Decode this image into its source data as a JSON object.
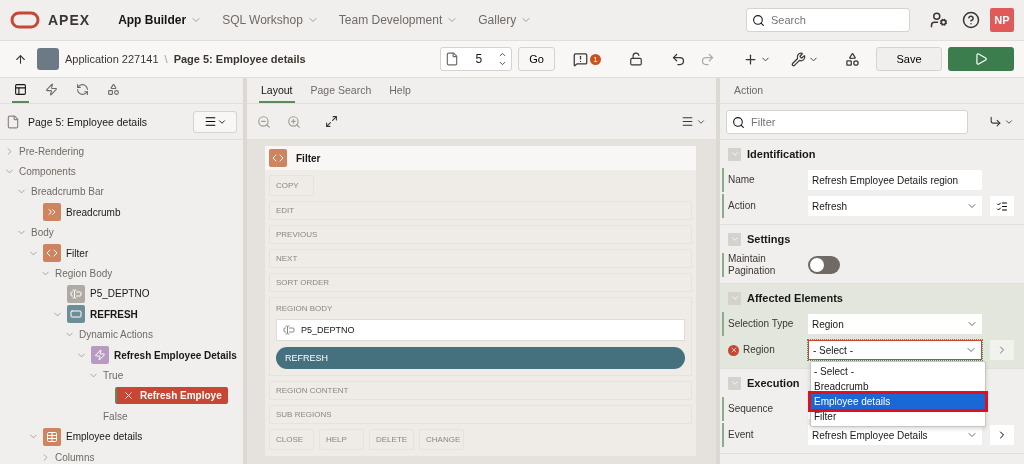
{
  "header": {
    "logo": "APEX",
    "nav": [
      {
        "label": "App Builder",
        "selected": true
      },
      {
        "label": "SQL Workshop",
        "selected": false
      },
      {
        "label": "Team Development",
        "selected": false
      },
      {
        "label": "Gallery",
        "selected": false
      }
    ],
    "search": {
      "placeholder": "Search"
    },
    "avatar": "NP"
  },
  "toolbar": {
    "application": "Application 227141",
    "separator": "\\",
    "page": "Page 5: Employee details",
    "page_number": "5",
    "go": "Go",
    "issues": "1",
    "save": "Save"
  },
  "left_panel": {
    "tabs": [
      {
        "selected": true
      },
      {
        "selected": false
      },
      {
        "selected": false
      },
      {
        "selected": false
      }
    ],
    "page_title": "Page 5: Employee details",
    "tree": [
      {
        "label": "Pre-Rendering",
        "expanded": false
      },
      {
        "label": "Components",
        "expanded": true,
        "children": [
          {
            "label": "Breadcrumb Bar",
            "expanded": true,
            "children": [
              {
                "label": "Breadcrumb",
                "kind": "breadcrumb",
                "bold": false,
                "selected": false
              }
            ]
          },
          {
            "label": "Body",
            "expanded": true,
            "children": [
              {
                "label": "Filter",
                "kind": "code",
                "bold": false,
                "selected": false,
                "expanded": true,
                "children": [
                  {
                    "label": "Region Body",
                    "expanded": true,
                    "children": [
                      {
                        "label": "P5_DEPTNO",
                        "kind": "item",
                        "bold": false,
                        "selected": false
                      },
                      {
                        "label": "REFRESH",
                        "kind": "button",
                        "bold": true,
                        "selected": false,
                        "expanded": true,
                        "children": [
                          {
                            "label": "Dynamic Actions",
                            "expanded": true,
                            "children": [
                              {
                                "label": "Refresh Employee Details",
                                "kind": "dynamic",
                                "bold": true,
                                "selected": false,
                                "expanded": true,
                                "children": [
                                  {
                                    "label": "True",
                                    "expanded": true,
                                    "children": [
                                      {
                                        "label": "Refresh Employe",
                                        "kind": "error",
                                        "bold": true,
                                        "selected": true
                                      }
                                    ]
                                  },
                                  {
                                    "label": "False"
                                  }
                                ]
                              }
                            ]
                          }
                        ]
                      }
                    ]
                  }
                ]
              },
              {
                "label": "Employee details",
                "kind": "table",
                "bold": false,
                "selected": false,
                "expanded": true,
                "children": [
                  {
                    "label": "Columns",
                    "expanded": false
                  }
                ]
              }
            ]
          }
        ]
      }
    ]
  },
  "middle_panel": {
    "tabs": [
      {
        "label": "Layout",
        "selected": true
      },
      {
        "label": "Page Search",
        "selected": false
      },
      {
        "label": "Help",
        "selected": false
      }
    ],
    "region": {
      "title": "Filter",
      "slots": [
        {
          "kind": "row",
          "items": [
            "COPY"
          ]
        },
        {
          "kind": "wide",
          "label": "EDIT"
        },
        {
          "kind": "wide",
          "label": "PREVIOUS"
        },
        {
          "kind": "wide",
          "label": "NEXT"
        },
        {
          "kind": "wide",
          "label": "SORT ORDER"
        },
        {
          "kind": "body",
          "label": "REGION BODY",
          "item": "P5_DEPTNO",
          "button": "REFRESH"
        },
        {
          "kind": "wide",
          "label": "REGION CONTENT"
        },
        {
          "kind": "wide",
          "label": "SUB REGIONS"
        },
        {
          "kind": "row",
          "items": [
            "CLOSE",
            "HELP",
            "DELETE",
            "CHANGE"
          ]
        }
      ]
    }
  },
  "right_panel": {
    "tab": "Action",
    "filter": {
      "placeholder": "Filter"
    },
    "groups": [
      {
        "title": "Identification",
        "highlighted": false,
        "properties": [
          {
            "label": "Name",
            "kind": "text",
            "value": "Refresh Employee Details region"
          },
          {
            "label": "Action",
            "kind": "select",
            "value": "Refresh",
            "side_button": {
              "kind": "list"
            }
          }
        ]
      },
      {
        "title": "Settings",
        "highlighted": false,
        "properties": [
          {
            "label": "Maintain Pagination",
            "kind": "switch",
            "on": false
          }
        ]
      },
      {
        "title": "Affected Elements",
        "highlighted": true,
        "properties": [
          {
            "label": "Selection Type",
            "kind": "select",
            "value": "Region"
          },
          {
            "label": "Region",
            "kind": "select",
            "value": "- Select -",
            "error": true,
            "open": true,
            "side_button": {
              "kind": "arrow"
            }
          }
        ]
      },
      {
        "title": "Execution",
        "highlighted": false,
        "properties": [
          {
            "label": "Sequence",
            "kind": "text"
          },
          {
            "label": "Event",
            "kind": "select",
            "value": "Refresh Employee Details",
            "side_button": {
              "kind": "arrow"
            }
          }
        ]
      }
    ],
    "dropdown": [
      {
        "label": "- Select -",
        "selected": false
      },
      {
        "label": "Breadcrumb",
        "selected": false
      },
      {
        "label": "Employee details",
        "selected": true
      },
      {
        "label": "Filter",
        "selected": false
      }
    ]
  }
}
